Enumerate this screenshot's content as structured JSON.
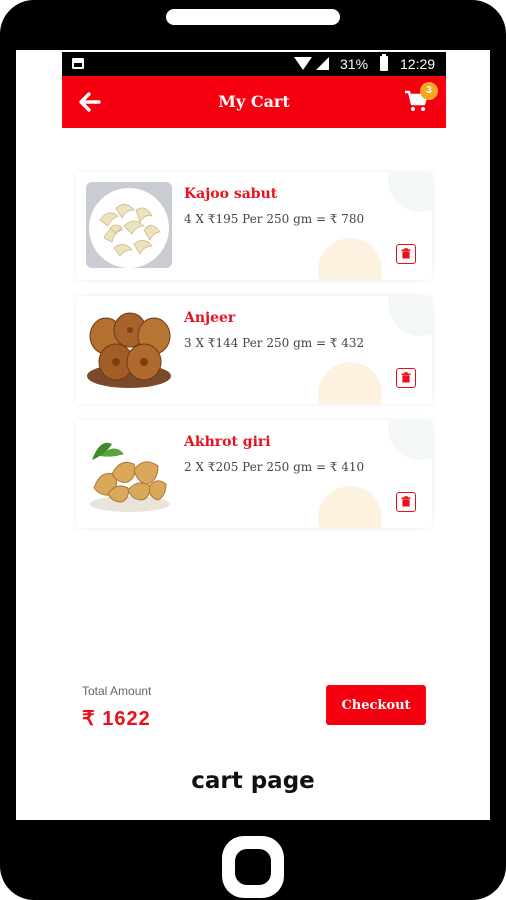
{
  "status_bar": {
    "battery": "31%",
    "time": "12:29"
  },
  "header": {
    "title": "My Cart",
    "cart_count": "3"
  },
  "cart_items": [
    {
      "name": "Kajoo sabut",
      "detail": "4 X ₹195 Per 250 gm = ₹ 780",
      "image": "cashew-image"
    },
    {
      "name": "Anjeer",
      "detail": "3 X ₹144 Per 250 gm = ₹ 432",
      "image": "fig-image"
    },
    {
      "name": "Akhrot giri",
      "detail": "2 X ₹205 Per 250 gm = ₹ 410",
      "image": "walnut-image"
    }
  ],
  "footer": {
    "total_label": "Total Amount",
    "total_value": "₹ 1622",
    "checkout_label": "Checkout"
  },
  "caption": "cart page",
  "colors": {
    "primary": "#f4000f",
    "badge": "#f6a623",
    "accent_text": "#e8101c"
  }
}
